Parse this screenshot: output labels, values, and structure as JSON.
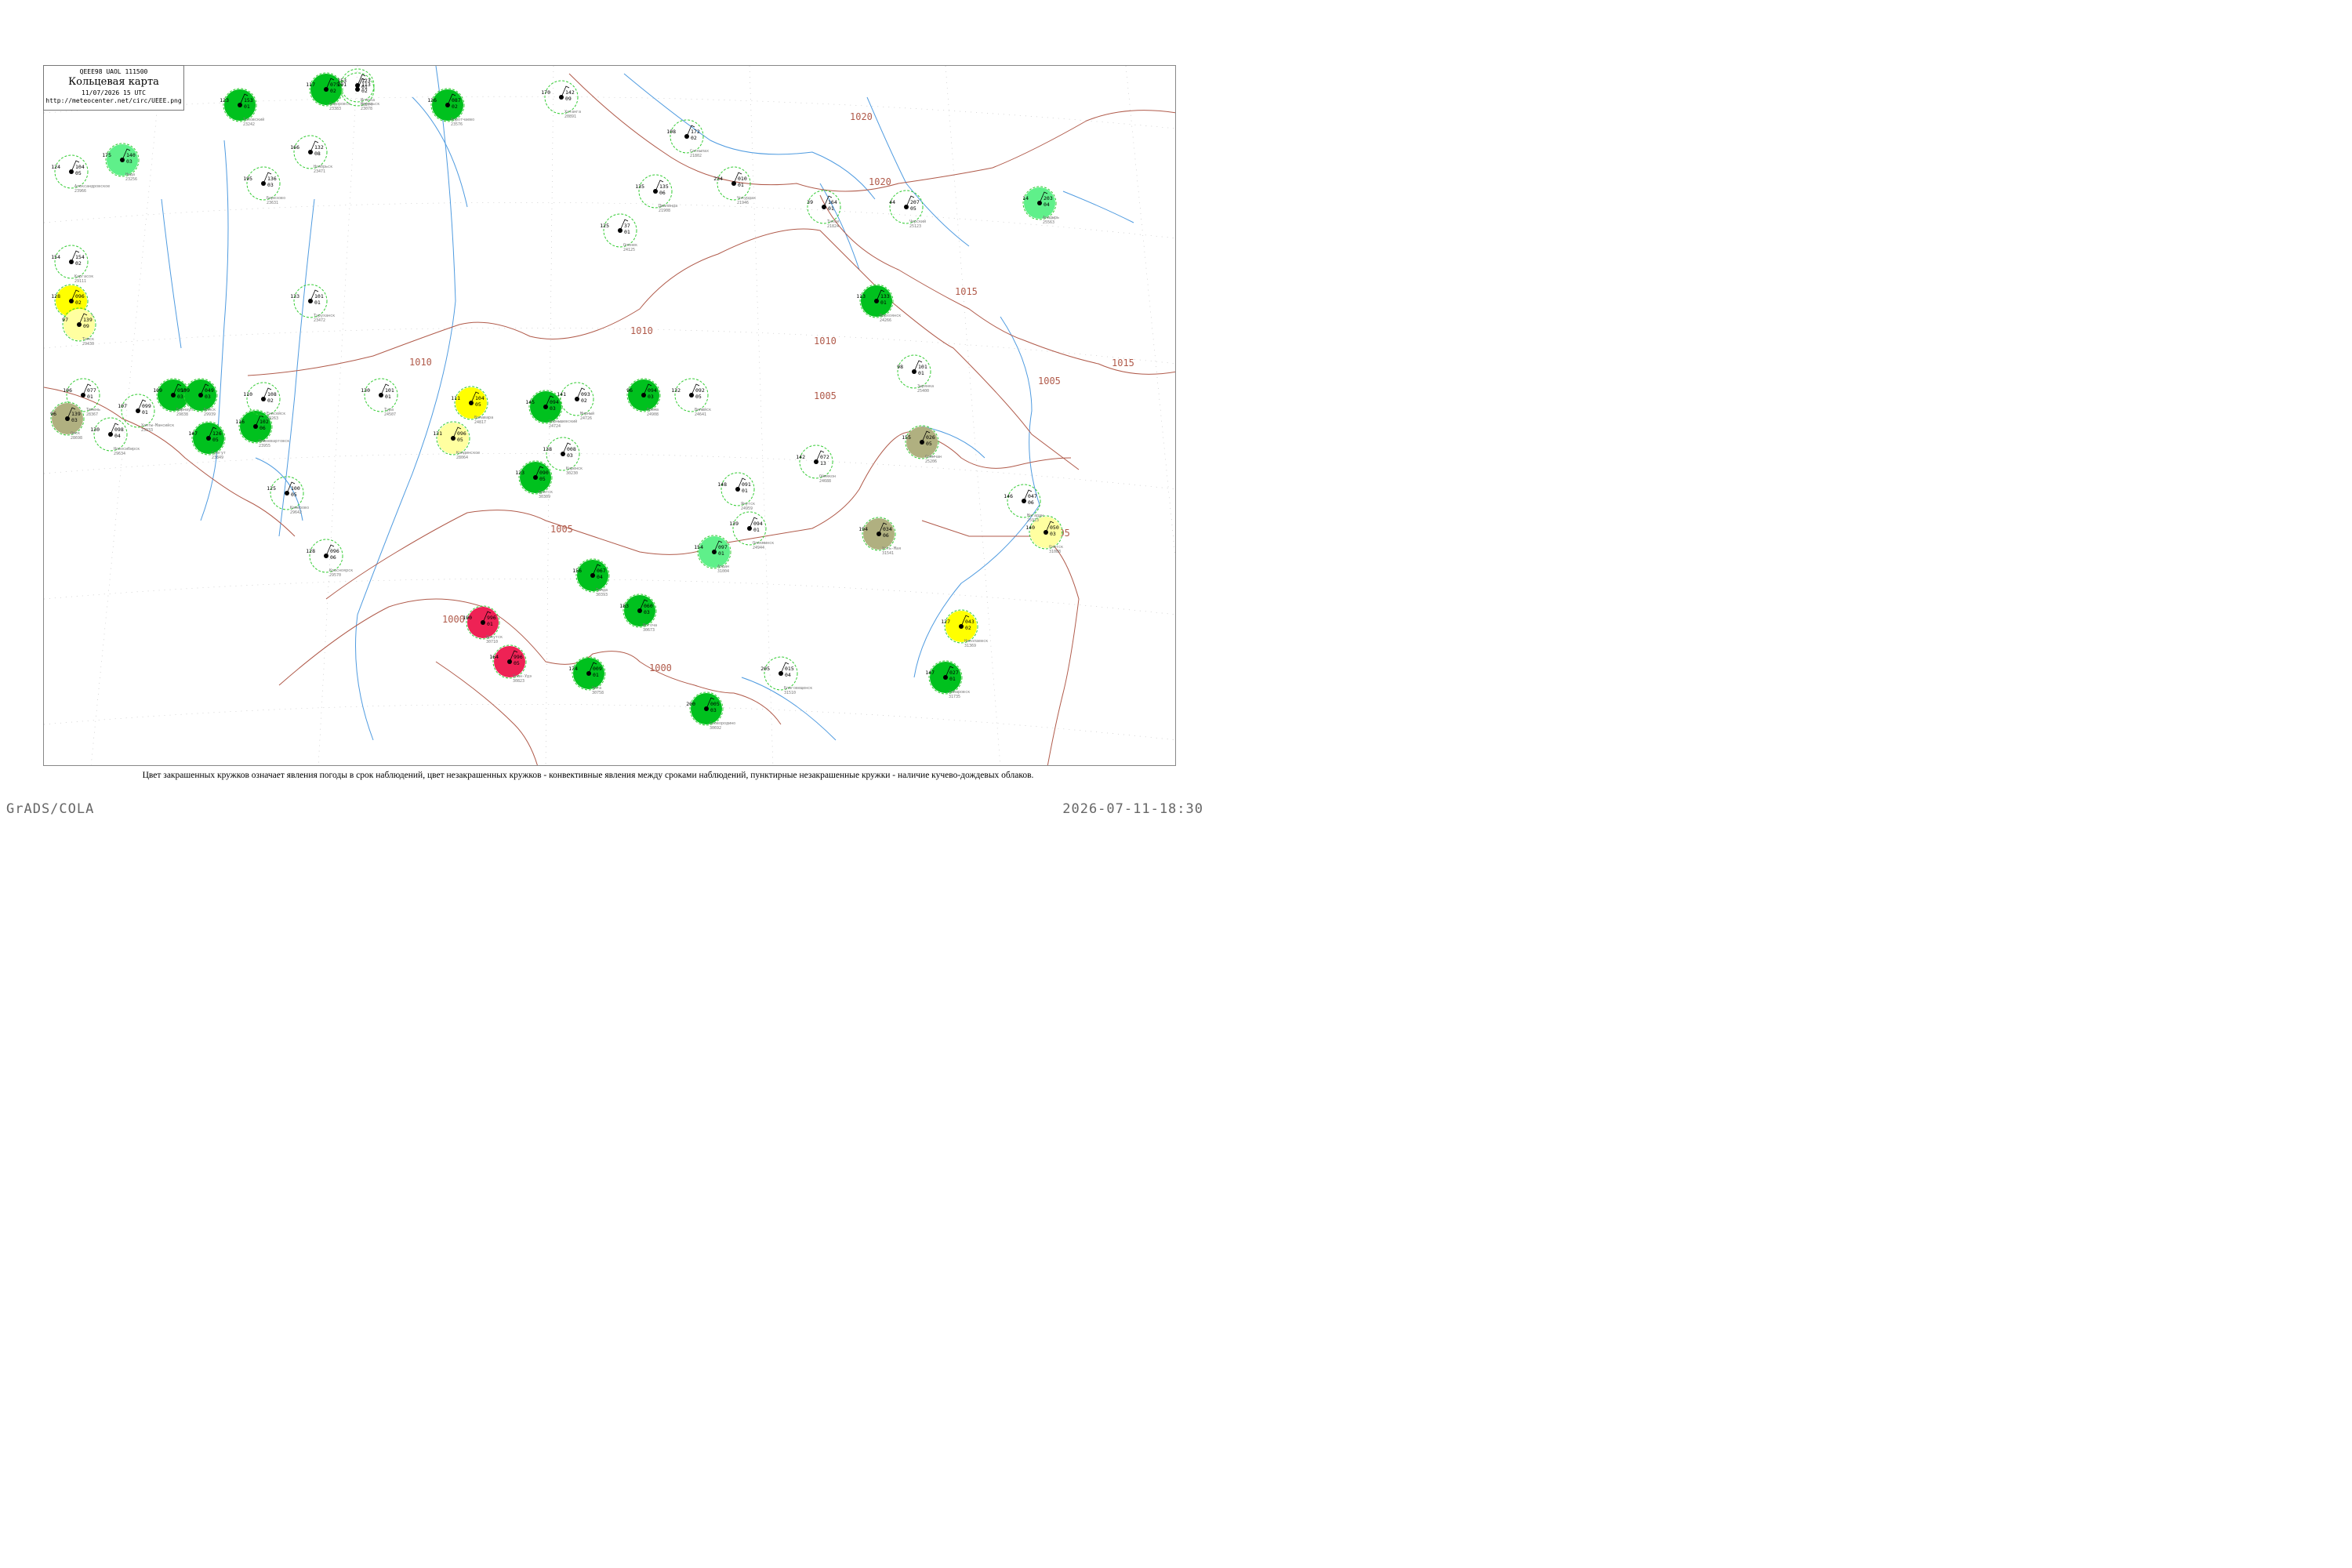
{
  "title_box": {
    "codes": "QEEE98  UAOL  111500",
    "title": "Кольцевая карта",
    "datetime": "11/07/2026 15 UTC",
    "url": "http://meteocenter.net/circ/UEEE.png"
  },
  "caption": "Цвет закрашенных кружков означает явления погоды в срок наблюдений, цвет незакрашенных кружков - конвективные явления между сроками наблюдений, пунктирные незакрашенные кружки - наличие кучево-дождевых облаков.",
  "footer": {
    "left": "GrADS/COLA",
    "right": "2026-07-11-18:30"
  },
  "colors": {
    "isobar": "#b05a4a",
    "river": "#4f9be0",
    "green_fill": "#00c11e",
    "light_green_fill": "#5ff08a",
    "yellow_fill": "#ffff00",
    "pale_yellow_fill": "#ffffa0",
    "red_fill": "#ee2255",
    "olive_fill": "#b0b080",
    "dashed_ring": "#3c3",
    "station_name": "#777777"
  },
  "isobars": [
    {
      "label": "1020"
    },
    {
      "label": "1020"
    },
    {
      "label": "1015"
    },
    {
      "label": "1015"
    },
    {
      "label": "1010"
    },
    {
      "label": "1010"
    },
    {
      "label": "1010"
    },
    {
      "label": "1005"
    },
    {
      "label": "1005"
    },
    {
      "label": "1005"
    },
    {
      "label": "1000"
    },
    {
      "label": "1000"
    },
    {
      "label": "1005"
    }
  ],
  "stations": [
    {
      "name": "Тазовский",
      "id": "23242",
      "t": "123",
      "p": "153",
      "pt": "01"
    },
    {
      "name": "Сидоровск",
      "id": "23383",
      "t": "117",
      "p": "075",
      "pt": "02"
    },
    {
      "name": "Коротчаево",
      "id": "23576",
      "t": "136",
      "p": "087",
      "pt": "02"
    },
    {
      "name": "Ныда",
      "id": "23256",
      "t": "175",
      "p": "140",
      "pt": "03"
    },
    {
      "name": "Ноябрьск",
      "id": "23471",
      "t": "166",
      "p": "132",
      "pt": "08"
    },
    {
      "name": "Березово",
      "id": "23631",
      "t": "195",
      "p": "136",
      "pt": "03"
    },
    {
      "name": "Кондинское",
      "id": "28064",
      "t": "131",
      "p": "096",
      "pt": "05"
    },
    {
      "name": "Ханты-Мансийск",
      "id": "23933",
      "t": "107",
      "p": "099",
      "pt": "01"
    },
    {
      "name": "Сургут",
      "id": "23849",
      "t": "147",
      "p": "126",
      "pt": "05"
    },
    {
      "name": "Нижневартовск",
      "id": "23955",
      "t": "116",
      "p": "102",
      "pt": "06"
    },
    {
      "name": "Александровское",
      "id": "23966",
      "t": "124",
      "p": "104",
      "pt": "05"
    },
    {
      "name": "Каргасок",
      "id": "29111",
      "t": "154",
      "p": "154",
      "pt": "02"
    },
    {
      "name": "Тобольск",
      "id": "28275",
      "t": "128",
      "p": "096",
      "pt": "02"
    },
    {
      "name": "Тюмень",
      "id": "28367",
      "t": "106",
      "p": "077",
      "pt": "01"
    },
    {
      "name": "Омск",
      "id": "28698",
      "t": "96",
      "p": "139",
      "pt": "03"
    },
    {
      "name": "Новосибирск",
      "id": "29634",
      "t": "130",
      "p": "098",
      "pt": "04"
    },
    {
      "name": "Томск",
      "id": "29430",
      "t": "97",
      "p": "139",
      "pt": "09"
    },
    {
      "name": "Барнаул",
      "id": "29838",
      "t": "109",
      "p": "058",
      "pt": "03"
    },
    {
      "name": "Бийск",
      "id": "29939",
      "t": "109",
      "p": "049",
      "pt": "03"
    },
    {
      "name": "Кемерово",
      "id": "29642",
      "t": "125",
      "p": "100",
      "pt": "05"
    },
    {
      "name": "Красноярск",
      "id": "29570",
      "t": "128",
      "p": "096",
      "pt": "06"
    },
    {
      "name": "Енисейск",
      "id": "29263",
      "t": "110",
      "p": "108",
      "pt": "02"
    },
    {
      "name": "Туруханск",
      "id": "23472",
      "t": "133",
      "p": "101",
      "pt": "01"
    },
    {
      "name": "Игарка",
      "id": "23274",
      "t": "153",
      "p": "123",
      "pt": "01"
    },
    {
      "name": "Норильск",
      "id": "23078",
      "t": "101",
      "p": "113",
      "pt": "02"
    },
    {
      "name": "Хатанга",
      "id": "20891",
      "t": "170",
      "p": "142",
      "pt": "09"
    },
    {
      "name": "Саскылах",
      "id": "21802",
      "t": "108",
      "p": "172",
      "pt": "02"
    },
    {
      "name": "Джалинда",
      "id": "21908",
      "t": "135",
      "p": "135",
      "pt": "06"
    },
    {
      "name": "Тура",
      "id": "24507",
      "t": "130",
      "p": "101",
      "pt": "01"
    },
    {
      "name": "Ванавара",
      "id": "24817",
      "t": "111",
      "p": "104",
      "pt": "05"
    },
    {
      "name": "Оленек",
      "id": "24125",
      "t": "125",
      "p": "37",
      "pt": "01"
    },
    {
      "name": "Вилюйск",
      "id": "24641",
      "t": "132",
      "p": "092",
      "pt": "05"
    },
    {
      "name": "Мирный",
      "id": "24726",
      "t": "141",
      "p": "093",
      "pt": "02"
    },
    {
      "name": "Чернышевский",
      "id": "24724",
      "t": "145",
      "p": "094",
      "pt": "03"
    },
    {
      "name": "Ерема",
      "id": "24908",
      "t": "96",
      "p": "094",
      "pt": "03"
    },
    {
      "name": "Киренск",
      "id": "30230",
      "t": "138",
      "p": "008",
      "pt": "03"
    },
    {
      "name": "Братск",
      "id": "30309",
      "t": "123",
      "p": "090",
      "pt": "05"
    },
    {
      "name": "Иркутск",
      "id": "30710",
      "t": "190",
      "p": "996",
      "pt": "01"
    },
    {
      "name": "Улан-Удэ",
      "id": "30823",
      "t": "164",
      "p": "996",
      "pt": "05"
    },
    {
      "name": "Чита",
      "id": "30758",
      "t": "174",
      "p": "009",
      "pt": "01"
    },
    {
      "name": "Якутск",
      "id": "24959",
      "t": "148",
      "p": "091",
      "pt": "01"
    },
    {
      "name": "Олекминск",
      "id": "24944",
      "t": "139",
      "p": "094",
      "pt": "01"
    },
    {
      "name": "Алдан",
      "id": "31004",
      "t": "154",
      "p": "097",
      "pt": "01"
    },
    {
      "name": "Тында",
      "id": "30393",
      "t": "156",
      "p": "067",
      "pt": "04"
    },
    {
      "name": "Могоча",
      "id": "30673",
      "t": "183",
      "p": "060",
      "pt": "03"
    },
    {
      "name": "Сковородино",
      "id": "30692",
      "t": "200",
      "p": "005",
      "pt": "03"
    },
    {
      "name": "Благовещенск",
      "id": "31510",
      "t": "205",
      "p": "015",
      "pt": "04"
    },
    {
      "name": "Верхоянск",
      "id": "24266",
      "t": "113",
      "p": "133",
      "pt": "01"
    },
    {
      "name": "Зырянка",
      "id": "25400",
      "t": "98",
      "p": "101",
      "pt": "01"
    },
    {
      "name": "Оймякон",
      "id": "24688",
      "t": "142",
      "p": "072",
      "pt": "13"
    },
    {
      "name": "Усть-Мая",
      "id": "31541",
      "t": "194",
      "p": "034",
      "pt": "06"
    },
    {
      "name": "Охотск",
      "id": "31088",
      "t": "140",
      "p": "050",
      "pt": "03"
    },
    {
      "name": "Николаевск",
      "id": "31369",
      "t": "127",
      "p": "043",
      "pt": "02"
    },
    {
      "name": "Хабаровск",
      "id": "31735",
      "t": "147",
      "p": "027",
      "pt": "01"
    },
    {
      "name": "Магадан",
      "id": "25913",
      "t": "146",
      "p": "047",
      "pt": "06"
    },
    {
      "name": "Сеймчан",
      "id": "25206",
      "t": "155",
      "p": "026",
      "pt": "05"
    },
    {
      "name": "Анадырь",
      "id": "25563",
      "t": "14",
      "p": "203",
      "pt": "04"
    },
    {
      "name": "Тикси",
      "id": "21824",
      "t": "39",
      "p": "164",
      "pt": "01"
    },
    {
      "name": "Чокурдах",
      "id": "21946",
      "t": "234",
      "p": "010",
      "pt": "01"
    },
    {
      "name": "Черский",
      "id": "25123",
      "t": "44",
      "p": "207",
      "pt": "05"
    }
  ]
}
